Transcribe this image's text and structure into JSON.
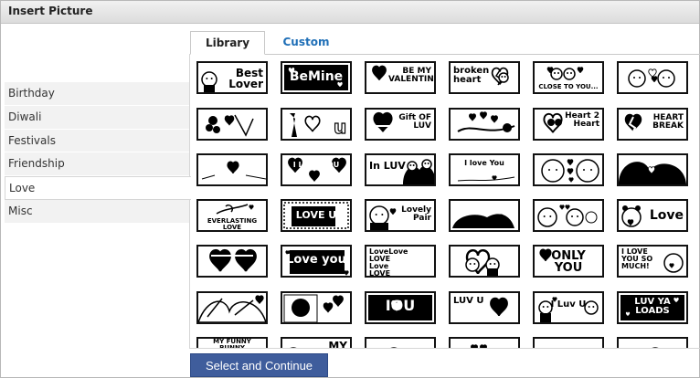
{
  "window": {
    "title": "Insert Picture"
  },
  "categories": [
    {
      "label": "Birthday",
      "active": false
    },
    {
      "label": "Diwali",
      "active": false
    },
    {
      "label": "Festivals",
      "active": false
    },
    {
      "label": "Friendship",
      "active": false
    },
    {
      "label": "Love",
      "active": true
    },
    {
      "label": "Misc",
      "active": false
    }
  ],
  "tabs": [
    {
      "label": "Library",
      "active": true
    },
    {
      "label": "Custom",
      "active": false
    }
  ],
  "pictures": [
    {
      "icon": "best-lover",
      "text": "Best Lover"
    },
    {
      "icon": "be-mine",
      "text": "BeMine"
    },
    {
      "icon": "be-my-valentine",
      "text": "BE MY VALENTINE"
    },
    {
      "icon": "broken-heart",
      "text": "broken heart"
    },
    {
      "icon": "close-to-you",
      "text": "CLOSE TO YOU..."
    },
    {
      "icon": "couple-hearts",
      "text": ""
    },
    {
      "icon": "flower-heart",
      "text": ""
    },
    {
      "icon": "i-love-u-tie",
      "text": ""
    },
    {
      "icon": "gift-of-luv",
      "text": "Gift OF LUV"
    },
    {
      "icon": "hearts-rose",
      "text": ""
    },
    {
      "icon": "heart-2-heart",
      "text": "Heart 2 Heart"
    },
    {
      "icon": "heart-break",
      "text": "HEART BREAK"
    },
    {
      "icon": "love-is-heart",
      "text": ""
    },
    {
      "icon": "i-love-you-hearts",
      "text": "I LOVE YOU"
    },
    {
      "icon": "in-luv",
      "text": "In LUV"
    },
    {
      "icon": "i-love-you-script",
      "text": "I love You"
    },
    {
      "icon": "boy-girl-hearts",
      "text": ""
    },
    {
      "icon": "kissing-couple",
      "text": ""
    },
    {
      "icon": "everlasting-love",
      "text": "EVERLASTING LOVE"
    },
    {
      "icon": "love-u-lace",
      "text": "LOVE U"
    },
    {
      "icon": "lovely-pair",
      "text": "Lovely Pair"
    },
    {
      "icon": "love-mice",
      "text": "Love"
    },
    {
      "icon": "couple-bubbles",
      "text": ""
    },
    {
      "icon": "teddy-love",
      "text": "Love"
    },
    {
      "icon": "twin-hearts",
      "text": ""
    },
    {
      "icon": "love-you-block",
      "text": "Love you"
    },
    {
      "icon": "lovelove-text",
      "text": "LoveLove LOVE Love LOVE LOVE"
    },
    {
      "icon": "heart-couple",
      "text": ""
    },
    {
      "icon": "only-you",
      "text": "ONLY YOU"
    },
    {
      "icon": "i-love-you-so-much",
      "text": "I LOVE YOU SO MUCH!"
    },
    {
      "icon": "kiss-sketch",
      "text": ""
    },
    {
      "icon": "face-hearts",
      "text": ""
    },
    {
      "icon": "iou-block",
      "text": "IOU"
    },
    {
      "icon": "luv-u-heart",
      "text": "LUV U"
    },
    {
      "icon": "i-luv-u-kids",
      "text": "I Luv U"
    },
    {
      "icon": "luv-ya-loads",
      "text": "LUV YA LOADS"
    },
    {
      "icon": "funny-bunny",
      "text": "MY FUNNY BUNNY"
    },
    {
      "icon": "my-valentine-partial",
      "text": "MY"
    },
    {
      "icon": "partial-a",
      "text": ""
    },
    {
      "icon": "partial-b",
      "text": ""
    },
    {
      "icon": "partial-c",
      "text": ""
    },
    {
      "icon": "partial-d",
      "text": ""
    }
  ],
  "footer": {
    "primary_button": "Select and Continue"
  },
  "colors": {
    "primary_button": "#3f5d9c",
    "tab_link": "#1f6fb7",
    "sidebar_bg": "#f2f2f2"
  }
}
